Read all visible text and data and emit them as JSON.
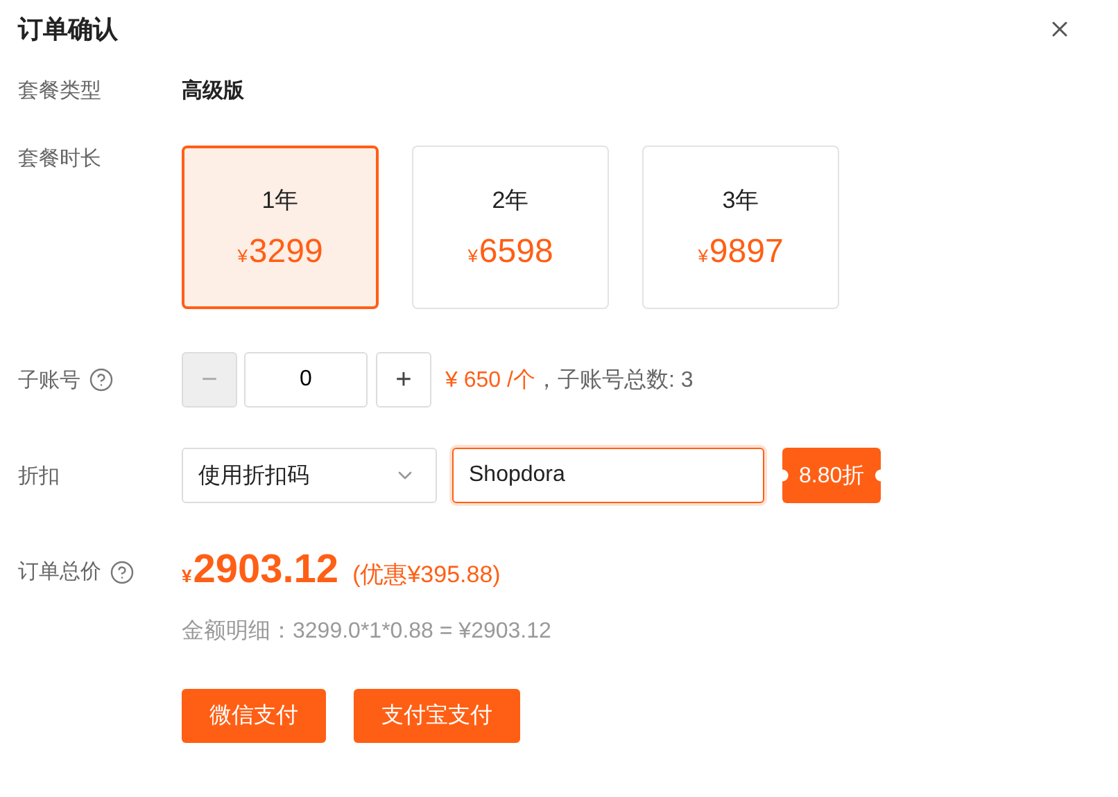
{
  "dialog": {
    "title": "订单确认"
  },
  "plan_type": {
    "label": "套餐类型",
    "value": "高级版"
  },
  "duration": {
    "label": "套餐时长",
    "options": [
      {
        "term": "1年",
        "currency": "¥",
        "price": "3299",
        "selected": true
      },
      {
        "term": "2年",
        "currency": "¥",
        "price": "6598",
        "selected": false
      },
      {
        "term": "3年",
        "currency": "¥",
        "price": "9897",
        "selected": false
      }
    ]
  },
  "sub_accounts": {
    "label": "子账号",
    "decrement": "−",
    "decrement_disabled": true,
    "value": "0",
    "increment": "+",
    "unit_price": "¥ 650 /个",
    "separator": "，",
    "total": "子账号总数: 3"
  },
  "discount": {
    "label": "折扣",
    "method": "使用折扣码",
    "code": "Shopdora",
    "rate": "8.80折"
  },
  "order_total": {
    "label": "订单总价",
    "currency": "¥",
    "amount": "2903.12",
    "savings": "(优惠¥395.88)",
    "breakdown": "金额明细：3299.0*1*0.88 = ¥2903.12"
  },
  "payment_buttons": [
    "微信支付",
    "支付宝支付"
  ]
}
